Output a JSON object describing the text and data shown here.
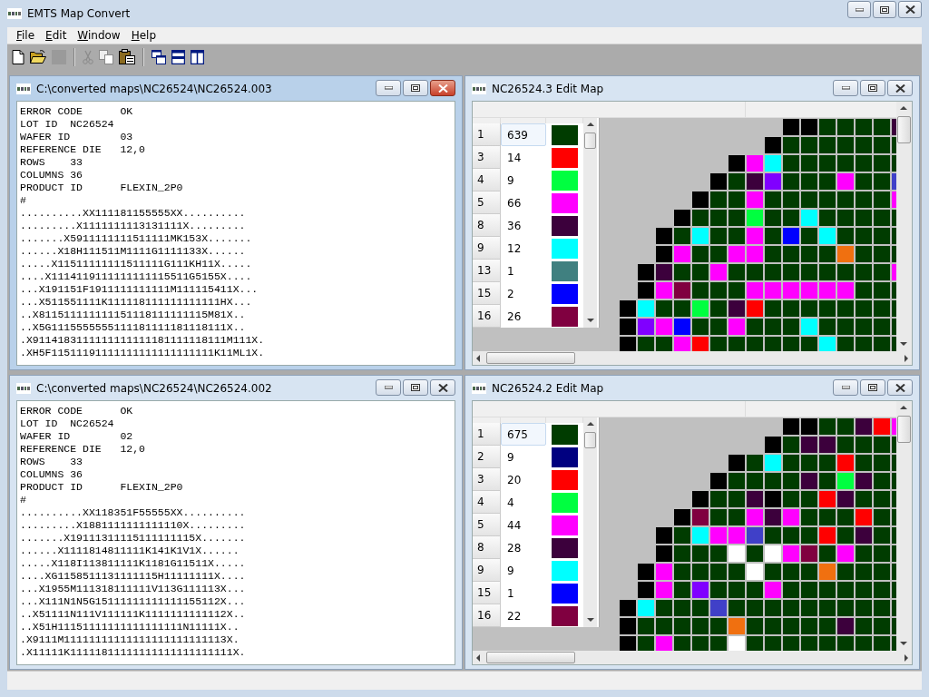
{
  "app": {
    "title": "EMTS Map Convert"
  },
  "menu": [
    {
      "label": "File"
    },
    {
      "label": "Edit"
    },
    {
      "label": "Window"
    },
    {
      "label": "Help"
    }
  ],
  "toolbar": [
    {
      "kind": "new",
      "disabled": false
    },
    {
      "kind": "open",
      "disabled": false
    },
    {
      "kind": "save",
      "disabled": true
    },
    {
      "kind": "separator"
    },
    {
      "kind": "cut",
      "disabled": true
    },
    {
      "kind": "copy",
      "disabled": true
    },
    {
      "kind": "paste",
      "disabled": false
    },
    {
      "kind": "separator"
    },
    {
      "kind": "cascade",
      "disabled": false
    },
    {
      "kind": "tile_horizontal",
      "disabled": false
    },
    {
      "kind": "tile_vertical",
      "disabled": false
    }
  ],
  "windows": [
    {
      "kind": "text",
      "title": "C:\\converted maps\\NC26524\\NC26524.003",
      "active": true,
      "lines": [
        "ERROR CODE      OK",
        "LOT ID  NC26524",
        "WAFER ID        03",
        "REFERENCE DIE   12,0",
        "ROWS    33",
        "COLUMNS 36",
        "PRODUCT ID      FLEXIN_2P0",
        "#",
        "..........XX111181155555XX..........",
        ".........X1111111113131111X.........",
        ".......X5911111111511111MK153X.......",
        "......X18H111511M1111G1111133X......",
        ".....X11511111111511111G111KH11X.....",
        "....X1114119111111111115511G5155X....",
        "...X191151F1911111111111M111115411X...",
        "...X511551111K111118111111111111HX...",
        "..X811511111111151118111111115M81X..",
        "..X5G1115555555111181111181118111X..",
        ".X9114183111111111111181111118111M111X.",
        ".XH5F11511191111111111111111111K11ML1X."
      ]
    },
    {
      "kind": "map",
      "title": "NC26524.3 Edit Map",
      "active": false,
      "legend": [
        {
          "bin": "1",
          "count": "639",
          "color": "#003c00",
          "selected": true
        },
        {
          "bin": "3",
          "count": "14",
          "color": "#ff0000",
          "selected": false
        },
        {
          "bin": "4",
          "count": "9",
          "color": "#00ff40",
          "selected": false
        },
        {
          "bin": "5",
          "count": "66",
          "color": "#ff00ff",
          "selected": false
        },
        {
          "bin": "8",
          "count": "36",
          "color": "#3c003c",
          "selected": false
        },
        {
          "bin": "9",
          "count": "12",
          "color": "#00ffff",
          "selected": false
        },
        {
          "bin": "13",
          "count": "1",
          "color": "#408080",
          "selected": false
        },
        {
          "bin": "15",
          "count": "2",
          "color": "#0000ff",
          "selected": false
        },
        {
          "bin": "16",
          "count": "26",
          "color": "#800040",
          "selected": false
        }
      ],
      "map_rows": [
        [
          null,
          null,
          null,
          null,
          null,
          null,
          null,
          null,
          null,
          {
            "color": "#000000"
          },
          {
            "color": "#000000"
          },
          {
            "color": "#003c00"
          },
          {
            "color": "#003c00"
          },
          {
            "color": "#003c00"
          },
          {
            "color": "#003c00"
          },
          {
            "color": "#3c003c"
          }
        ],
        [
          null,
          null,
          null,
          null,
          null,
          null,
          null,
          null,
          {
            "color": "#000000"
          },
          {
            "color": "#003c00"
          },
          {
            "color": "#003c00"
          },
          {
            "color": "#003c00"
          },
          {
            "color": "#003c00"
          },
          {
            "color": "#003c00"
          },
          {
            "color": "#003c00"
          },
          {
            "color": "#003c00"
          }
        ],
        [
          null,
          null,
          null,
          null,
          null,
          null,
          {
            "color": "#000000"
          },
          {
            "color": "#ff00ff"
          },
          {
            "color": "#00ffff"
          },
          {
            "color": "#003c00"
          },
          {
            "color": "#003c00"
          },
          {
            "color": "#003c00"
          },
          {
            "color": "#003c00"
          },
          {
            "color": "#003c00"
          },
          {
            "color": "#003c00"
          },
          {
            "color": "#003c00"
          }
        ],
        [
          null,
          null,
          null,
          null,
          null,
          {
            "color": "#000000"
          },
          {
            "color": "#003c00"
          },
          {
            "color": "#3c003c"
          },
          {
            "color": "#8000ff"
          },
          {
            "color": "#003c00"
          },
          {
            "color": "#003c00"
          },
          {
            "color": "#003c00"
          },
          {
            "color": "#ff00ff"
          },
          {
            "color": "#003c00"
          },
          {
            "color": "#003c00"
          },
          {
            "color": "#4040c8"
          }
        ],
        [
          null,
          null,
          null,
          null,
          {
            "color": "#000000"
          },
          {
            "color": "#003c00"
          },
          {
            "color": "#003c00"
          },
          {
            "color": "#ff00ff"
          },
          {
            "color": "#003c00"
          },
          {
            "color": "#003c00"
          },
          {
            "color": "#003c00"
          },
          {
            "color": "#003c00"
          },
          {
            "color": "#003c00"
          },
          {
            "color": "#003c00"
          },
          {
            "color": "#003c00"
          },
          {
            "color": "#ff00ff"
          }
        ],
        [
          null,
          null,
          null,
          {
            "color": "#000000"
          },
          {
            "color": "#003c00"
          },
          {
            "color": "#003c00"
          },
          {
            "color": "#003c00"
          },
          {
            "color": "#00ff40"
          },
          {
            "color": "#003c00"
          },
          {
            "color": "#003c00"
          },
          {
            "color": "#00ffff"
          },
          {
            "color": "#003c00"
          },
          {
            "color": "#003c00"
          },
          {
            "color": "#003c00"
          },
          {
            "color": "#003c00"
          },
          {
            "color": "#003c00"
          }
        ],
        [
          null,
          null,
          {
            "color": "#000000"
          },
          {
            "color": "#003c00"
          },
          {
            "color": "#00ffff"
          },
          {
            "color": "#003c00"
          },
          {
            "color": "#003c00"
          },
          {
            "color": "#ff00ff"
          },
          {
            "color": "#003c00"
          },
          {
            "color": "#0000ff"
          },
          {
            "color": "#003c00"
          },
          {
            "color": "#00ffff"
          },
          {
            "color": "#003c00"
          },
          {
            "color": "#003c00"
          },
          {
            "color": "#003c00"
          },
          {
            "color": "#003c00"
          }
        ],
        [
          null,
          null,
          {
            "color": "#000000"
          },
          {
            "color": "#ff00ff"
          },
          {
            "color": "#003c00"
          },
          {
            "color": "#003c00"
          },
          {
            "color": "#ff00ff"
          },
          {
            "color": "#ff00ff"
          },
          {
            "color": "#003c00"
          },
          {
            "color": "#003c00"
          },
          {
            "color": "#003c00"
          },
          {
            "color": "#003c00"
          },
          {
            "color": "#f07010"
          },
          {
            "color": "#003c00"
          },
          {
            "color": "#003c00"
          },
          {
            "color": "#003c00"
          }
        ],
        [
          null,
          {
            "color": "#000000"
          },
          {
            "color": "#3c003c"
          },
          {
            "color": "#003c00"
          },
          {
            "color": "#003c00"
          },
          {
            "color": "#ff00ff"
          },
          {
            "color": "#003c00"
          },
          {
            "color": "#003c00"
          },
          {
            "color": "#003c00"
          },
          {
            "color": "#003c00"
          },
          {
            "color": "#003c00"
          },
          {
            "color": "#003c00"
          },
          {
            "color": "#003c00"
          },
          {
            "color": "#003c00"
          },
          {
            "color": "#003c00"
          },
          {
            "color": "#ff00ff"
          }
        ],
        [
          null,
          {
            "color": "#000000"
          },
          {
            "color": "#ff00ff"
          },
          {
            "color": "#800040"
          },
          {
            "color": "#003c00"
          },
          {
            "color": "#003c00"
          },
          {
            "color": "#003c00"
          },
          {
            "color": "#ff00ff"
          },
          {
            "color": "#ff00ff"
          },
          {
            "color": "#ff00ff"
          },
          {
            "color": "#ff00ff"
          },
          {
            "color": "#ff00ff"
          },
          {
            "color": "#ff00ff"
          },
          {
            "color": "#003c00"
          },
          {
            "color": "#003c00"
          },
          {
            "color": "#003c00"
          }
        ],
        [
          {
            "color": "#000000"
          },
          {
            "color": "#00ffff"
          },
          {
            "color": "#003c00"
          },
          {
            "color": "#003c00"
          },
          {
            "color": "#00ff40"
          },
          {
            "color": "#003c00"
          },
          {
            "color": "#3c003c"
          },
          {
            "color": "#ff0000"
          },
          {
            "color": "#003c00"
          },
          {
            "color": "#003c00"
          },
          {
            "color": "#003c00"
          },
          {
            "color": "#003c00"
          },
          {
            "color": "#003c00"
          },
          {
            "color": "#003c00"
          },
          {
            "color": "#003c00"
          },
          {
            "color": "#003c00"
          }
        ],
        [
          {
            "color": "#000000"
          },
          {
            "color": "#8000ff"
          },
          {
            "color": "#ff00ff"
          },
          {
            "color": "#0000ff"
          },
          {
            "color": "#003c00"
          },
          {
            "color": "#003c00"
          },
          {
            "color": "#ff00ff"
          },
          {
            "color": "#003c00"
          },
          {
            "color": "#003c00"
          },
          {
            "color": "#003c00"
          },
          {
            "color": "#00ffff"
          },
          {
            "color": "#003c00"
          },
          {
            "color": "#003c00"
          },
          {
            "color": "#003c00"
          },
          {
            "color": "#003c00"
          },
          {
            "color": "#003c00"
          }
        ],
        [
          {
            "color": "#000000"
          },
          {
            "color": "#003c00"
          },
          {
            "color": "#003c00"
          },
          {
            "color": "#ff00ff"
          },
          {
            "color": "#ff0000"
          },
          {
            "color": "#003c00"
          },
          {
            "color": "#003c00"
          },
          {
            "color": "#003c00"
          },
          {
            "color": "#003c00"
          },
          {
            "color": "#003c00"
          },
          {
            "color": "#003c00"
          },
          {
            "color": "#00ffff"
          },
          {
            "color": "#003c00"
          },
          {
            "color": "#003c00"
          },
          {
            "color": "#003c00"
          },
          {
            "color": "#003c00"
          }
        ]
      ]
    },
    {
      "kind": "text",
      "title": "C:\\converted maps\\NC26524\\NC26524.002",
      "active": false,
      "lines": [
        "ERROR CODE      OK",
        "LOT ID  NC26524",
        "WAFER ID        02",
        "REFERENCE DIE   12,0",
        "ROWS    33",
        "COLUMNS 36",
        "PRODUCT ID      FLEXIN_2P0",
        "#",
        "..........XX118351F55555XX..........",
        ".........X1881111111111110X.........",
        ".......X19111311115111111115X.......",
        "......X1111814811111K141K1V1X......",
        ".....X118I113811111K1181G11511X.....",
        "....XG1158511131111115H11111111X....",
        "...X1955M111318111111V113G111113X...",
        "...X111N1N5G15111111111111155112X...",
        "..X51111N111V111111K1111111111112X..",
        "..X51H11151111111111111111N11111X..",
        ".X9111M11111111111111111111111113X.",
        ".X11111K11111811111111111111111111X."
      ]
    },
    {
      "kind": "map",
      "title": "NC26524.2 Edit Map",
      "active": false,
      "legend": [
        {
          "bin": "1",
          "count": "675",
          "color": "#003c00",
          "selected": true
        },
        {
          "bin": "2",
          "count": "9",
          "color": "#000080",
          "selected": false
        },
        {
          "bin": "3",
          "count": "20",
          "color": "#ff0000",
          "selected": false
        },
        {
          "bin": "4",
          "count": "4",
          "color": "#00ff40",
          "selected": false
        },
        {
          "bin": "5",
          "count": "44",
          "color": "#ff00ff",
          "selected": false
        },
        {
          "bin": "8",
          "count": "28",
          "color": "#3c003c",
          "selected": false
        },
        {
          "bin": "9",
          "count": "9",
          "color": "#00ffff",
          "selected": false
        },
        {
          "bin": "15",
          "count": "1",
          "color": "#0000ff",
          "selected": false
        },
        {
          "bin": "16",
          "count": "22",
          "color": "#800040",
          "selected": false
        }
      ],
      "map_rows": [
        [
          null,
          null,
          null,
          null,
          null,
          null,
          null,
          null,
          null,
          {
            "color": "#000000"
          },
          {
            "color": "#000000"
          },
          {
            "color": "#003c00"
          },
          {
            "color": "#003c00"
          },
          {
            "color": "#3c003c"
          },
          {
            "color": "#ff0000"
          },
          {
            "color": "#ff00ff"
          }
        ],
        [
          null,
          null,
          null,
          null,
          null,
          null,
          null,
          null,
          {
            "color": "#000000"
          },
          {
            "color": "#003c00"
          },
          {
            "color": "#3c003c"
          },
          {
            "color": "#3c003c"
          },
          {
            "color": "#003c00"
          },
          {
            "color": "#003c00"
          },
          {
            "color": "#003c00"
          },
          {
            "color": "#003c00"
          }
        ],
        [
          null,
          null,
          null,
          null,
          null,
          null,
          {
            "color": "#000000"
          },
          {
            "color": "#003c00"
          },
          {
            "color": "#00ffff"
          },
          {
            "color": "#003c00"
          },
          {
            "color": "#003c00"
          },
          {
            "color": "#003c00"
          },
          {
            "color": "#ff0000"
          },
          {
            "color": "#003c00"
          },
          {
            "color": "#003c00"
          },
          {
            "color": "#003c00"
          }
        ],
        [
          null,
          null,
          null,
          null,
          null,
          {
            "color": "#000000"
          },
          {
            "color": "#003c00"
          },
          {
            "color": "#003c00"
          },
          {
            "color": "#003c00"
          },
          {
            "color": "#003c00"
          },
          {
            "color": "#3c003c"
          },
          {
            "color": "#003c00"
          },
          {
            "color": "#00ff40"
          },
          {
            "color": "#3c003c"
          },
          {
            "color": "#003c00"
          },
          {
            "color": "#003c00"
          }
        ],
        [
          null,
          null,
          null,
          null,
          {
            "color": "#000000"
          },
          {
            "color": "#003c00"
          },
          {
            "color": "#003c00"
          },
          {
            "color": "#3c003c"
          },
          {
            "color": "#000000"
          },
          {
            "color": "#003c00"
          },
          {
            "color": "#003c00"
          },
          {
            "color": "#ff0000"
          },
          {
            "color": "#3c003c"
          },
          {
            "color": "#003c00"
          },
          {
            "color": "#003c00"
          },
          {
            "color": "#003c00"
          }
        ],
        [
          null,
          null,
          null,
          {
            "color": "#000000"
          },
          {
            "color": "#800040"
          },
          {
            "color": "#003c00"
          },
          {
            "color": "#003c00"
          },
          {
            "color": "#ff00ff"
          },
          {
            "color": "#3c003c"
          },
          {
            "color": "#ff00ff"
          },
          {
            "color": "#003c00"
          },
          {
            "color": "#003c00"
          },
          {
            "color": "#003c00"
          },
          {
            "color": "#ff0000"
          },
          {
            "color": "#003c00"
          },
          {
            "color": "#003c00"
          }
        ],
        [
          null,
          null,
          {
            "color": "#000000"
          },
          {
            "color": "#003c00"
          },
          {
            "color": "#00ffff"
          },
          {
            "color": "#ff00ff"
          },
          {
            "color": "#ff00ff"
          },
          {
            "color": "#4040c8"
          },
          {
            "color": "#003c00"
          },
          {
            "color": "#003c00"
          },
          {
            "color": "#003c00"
          },
          {
            "color": "#ff0000"
          },
          {
            "color": "#003c00"
          },
          {
            "color": "#3c003c"
          },
          {
            "color": "#003c00"
          },
          {
            "color": "#003c00"
          }
        ],
        [
          null,
          null,
          {
            "color": "#000000"
          },
          {
            "color": "#003c00"
          },
          {
            "color": "#003c00"
          },
          {
            "color": "#003c00"
          },
          {
            "color": "#ffffff"
          },
          {
            "color": "#003c00"
          },
          {
            "color": "#ffffff"
          },
          {
            "color": "#ff00ff"
          },
          {
            "color": "#800040"
          },
          {
            "color": "#003c00"
          },
          {
            "color": "#ff00ff"
          },
          {
            "color": "#003c00"
          },
          {
            "color": "#003c00"
          },
          {
            "color": "#003c00"
          }
        ],
        [
          null,
          {
            "color": "#000000"
          },
          {
            "color": "#ff00ff"
          },
          {
            "color": "#003c00"
          },
          {
            "color": "#003c00"
          },
          {
            "color": "#003c00"
          },
          {
            "color": "#003c00"
          },
          {
            "color": "#ffffff"
          },
          {
            "color": "#003c00"
          },
          {
            "color": "#003c00"
          },
          {
            "color": "#003c00"
          },
          {
            "color": "#f07010"
          },
          {
            "color": "#003c00"
          },
          {
            "color": "#003c00"
          },
          {
            "color": "#003c00"
          },
          {
            "color": "#003c00"
          }
        ],
        [
          null,
          {
            "color": "#000000"
          },
          {
            "color": "#ff00ff"
          },
          {
            "color": "#003c00"
          },
          {
            "color": "#8000ff"
          },
          {
            "color": "#003c00"
          },
          {
            "color": "#003c00"
          },
          {
            "color": "#003c00"
          },
          {
            "color": "#ff00ff"
          },
          {
            "color": "#003c00"
          },
          {
            "color": "#003c00"
          },
          {
            "color": "#003c00"
          },
          {
            "color": "#003c00"
          },
          {
            "color": "#003c00"
          },
          {
            "color": "#003c00"
          },
          {
            "color": "#003c00"
          }
        ],
        [
          {
            "color": "#000000"
          },
          {
            "color": "#00ffff"
          },
          {
            "color": "#003c00"
          },
          {
            "color": "#003c00"
          },
          {
            "color": "#003c00"
          },
          {
            "color": "#4040c8"
          },
          {
            "color": "#003c00"
          },
          {
            "color": "#003c00"
          },
          {
            "color": "#003c00"
          },
          {
            "color": "#003c00"
          },
          {
            "color": "#003c00"
          },
          {
            "color": "#003c00"
          },
          {
            "color": "#003c00"
          },
          {
            "color": "#003c00"
          },
          {
            "color": "#003c00"
          },
          {
            "color": "#003c00"
          }
        ],
        [
          {
            "color": "#000000"
          },
          {
            "color": "#003c00"
          },
          {
            "color": "#003c00"
          },
          {
            "color": "#003c00"
          },
          {
            "color": "#003c00"
          },
          {
            "color": "#003c00"
          },
          {
            "color": "#f07010"
          },
          {
            "color": "#003c00"
          },
          {
            "color": "#003c00"
          },
          {
            "color": "#003c00"
          },
          {
            "color": "#003c00"
          },
          {
            "color": "#003c00"
          },
          {
            "color": "#3c003c"
          },
          {
            "color": "#003c00"
          },
          {
            "color": "#003c00"
          },
          {
            "color": "#003c00"
          }
        ],
        [
          {
            "color": "#000000"
          },
          {
            "color": "#003c00"
          },
          {
            "color": "#ff00ff"
          },
          {
            "color": "#003c00"
          },
          {
            "color": "#003c00"
          },
          {
            "color": "#003c00"
          },
          {
            "color": "#ffffff"
          },
          {
            "color": "#003c00"
          },
          {
            "color": "#003c00"
          },
          {
            "color": "#003c00"
          },
          {
            "color": "#003c00"
          },
          {
            "color": "#003c00"
          },
          {
            "color": "#003c00"
          },
          {
            "color": "#003c00"
          },
          {
            "color": "#003c00"
          },
          {
            "color": "#003c00"
          }
        ]
      ]
    }
  ]
}
